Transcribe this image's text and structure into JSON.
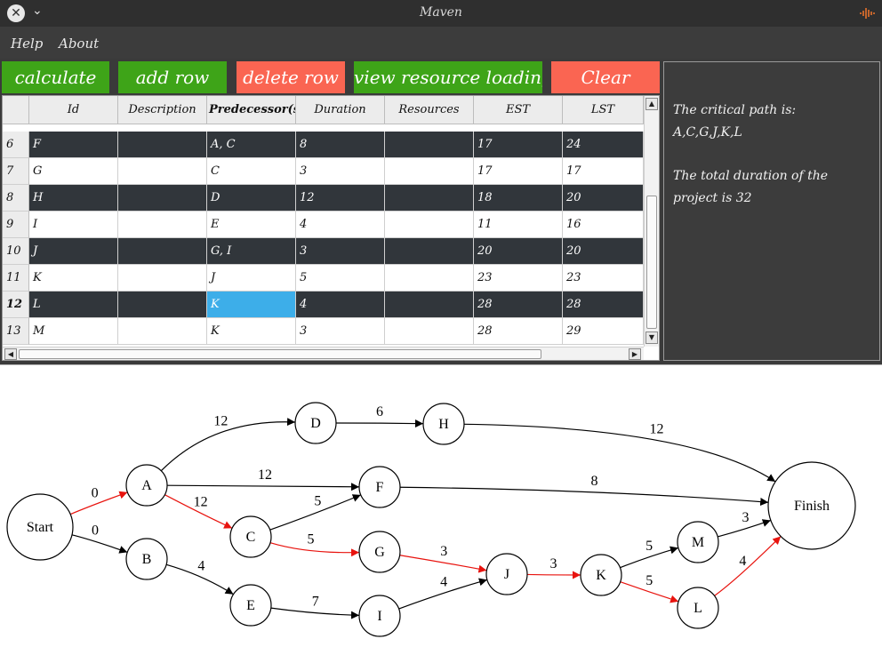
{
  "window": {
    "title": "Maven",
    "close_icon": "close-icon",
    "menu_icon": "chevron-down-icon",
    "logo_icon": "audio-wave-icon"
  },
  "menu": {
    "help": "Help",
    "about": "About"
  },
  "toolbar": {
    "calculate": "calculate",
    "add_row": "add row",
    "delete_row": "delete row",
    "view_resource_loading": "view resource loading",
    "clear": "Clear"
  },
  "colors": {
    "green": "#3ea418",
    "red": "#fa6552",
    "dark_row": "#31363b",
    "selection": "#3daee9",
    "critical_edge": "#e8130e"
  },
  "table": {
    "headers": [
      "Id",
      "Description",
      "Predecessor(s)",
      "Duration",
      "Resources",
      "EST",
      "LST"
    ],
    "rows": [
      {
        "num": "6",
        "id": "F",
        "description": "",
        "predecessors": "A, C",
        "duration": "8",
        "resources": "",
        "est": "17",
        "lst": "24"
      },
      {
        "num": "7",
        "id": "G",
        "description": "",
        "predecessors": "C",
        "duration": "3",
        "resources": "",
        "est": "17",
        "lst": "17"
      },
      {
        "num": "8",
        "id": "H",
        "description": "",
        "predecessors": "D",
        "duration": "12",
        "resources": "",
        "est": "18",
        "lst": "20"
      },
      {
        "num": "9",
        "id": "I",
        "description": "",
        "predecessors": "E",
        "duration": "4",
        "resources": "",
        "est": "11",
        "lst": "16"
      },
      {
        "num": "10",
        "id": "J",
        "description": "",
        "predecessors": "G, I",
        "duration": "3",
        "resources": "",
        "est": "20",
        "lst": "20"
      },
      {
        "num": "11",
        "id": "K",
        "description": "",
        "predecessors": "J",
        "duration": "5",
        "resources": "",
        "est": "23",
        "lst": "23"
      },
      {
        "num": "12",
        "id": "L",
        "description": "",
        "predecessors": "K",
        "duration": "4",
        "resources": "",
        "est": "28",
        "lst": "28"
      },
      {
        "num": "13",
        "id": "M",
        "description": "",
        "predecessors": "K",
        "duration": "3",
        "resources": "",
        "est": "28",
        "lst": "29"
      }
    ]
  },
  "results": {
    "critical_path_label": "The critical path is:",
    "critical_path": "A,C,G,J,K,L",
    "duration_text": "The total duration of the project is 32"
  },
  "graph": {
    "nodes": [
      "Start",
      "A",
      "B",
      "C",
      "D",
      "E",
      "F",
      "G",
      "H",
      "I",
      "J",
      "K",
      "L",
      "M",
      "Finish"
    ],
    "edges": [
      {
        "from": "Start",
        "to": "A",
        "weight": "0",
        "critical": true
      },
      {
        "from": "Start",
        "to": "B",
        "weight": "0",
        "critical": false
      },
      {
        "from": "A",
        "to": "D",
        "weight": "12",
        "critical": false
      },
      {
        "from": "A",
        "to": "F",
        "weight": "12",
        "critical": false
      },
      {
        "from": "A",
        "to": "C",
        "weight": "12",
        "critical": true
      },
      {
        "from": "B",
        "to": "E",
        "weight": "4",
        "critical": false
      },
      {
        "from": "C",
        "to": "F",
        "weight": "5",
        "critical": false
      },
      {
        "from": "C",
        "to": "G",
        "weight": "5",
        "critical": true
      },
      {
        "from": "D",
        "to": "H",
        "weight": "6",
        "critical": false
      },
      {
        "from": "E",
        "to": "I",
        "weight": "7",
        "critical": false
      },
      {
        "from": "F",
        "to": "Finish",
        "weight": "8",
        "critical": false
      },
      {
        "from": "G",
        "to": "J",
        "weight": "3",
        "critical": true
      },
      {
        "from": "H",
        "to": "Finish",
        "weight": "12",
        "critical": false
      },
      {
        "from": "I",
        "to": "J",
        "weight": "4",
        "critical": false
      },
      {
        "from": "J",
        "to": "K",
        "weight": "3",
        "critical": true
      },
      {
        "from": "K",
        "to": "M",
        "weight": "5",
        "critical": false
      },
      {
        "from": "K",
        "to": "L",
        "weight": "5",
        "critical": true
      },
      {
        "from": "M",
        "to": "Finish",
        "weight": "3",
        "critical": false
      },
      {
        "from": "L",
        "to": "Finish",
        "weight": "4",
        "critical": true
      }
    ]
  }
}
